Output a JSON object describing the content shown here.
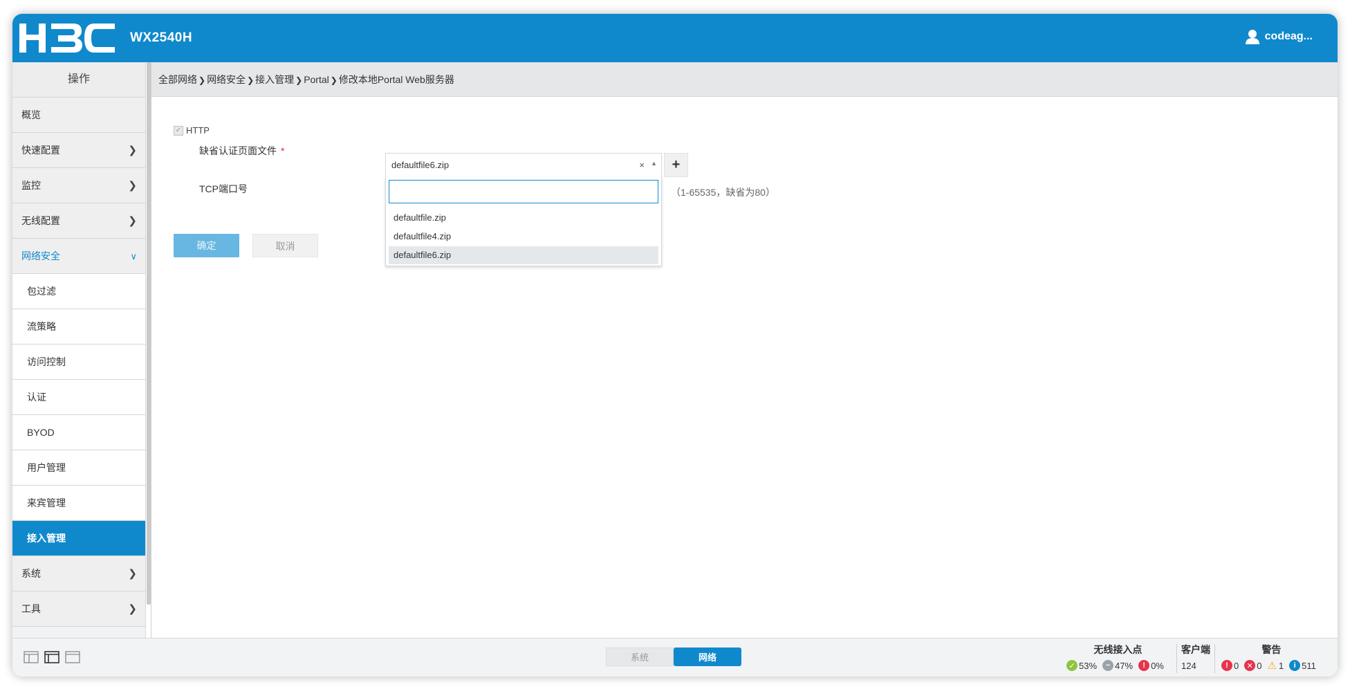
{
  "header": {
    "logo": "H3C",
    "model": "WX2540H",
    "user": "codeag..."
  },
  "sidebar": {
    "title": "操作",
    "items": [
      {
        "label": "概览"
      },
      {
        "label": "快速配置"
      },
      {
        "label": "监控"
      },
      {
        "label": "无线配置"
      },
      {
        "label": "网络安全"
      },
      {
        "label": "包过滤"
      },
      {
        "label": "流策略"
      },
      {
        "label": "访问控制"
      },
      {
        "label": "认证"
      },
      {
        "label": "BYOD"
      },
      {
        "label": "用户管理"
      },
      {
        "label": "来宾管理"
      },
      {
        "label": "接入管理"
      },
      {
        "label": "系统"
      },
      {
        "label": "工具"
      }
    ]
  },
  "breadcrumb": [
    "全部网络",
    "网络安全",
    "接入管理",
    "Portal",
    "修改本地Portal Web服务器"
  ],
  "form": {
    "http_label": "HTTP",
    "file_label": "缺省认证页面文件",
    "required_mark": "*",
    "selected_file": "defaultfile6.zip",
    "clear_symbol": "×",
    "add_symbol": "+",
    "port_label": "TCP端口号",
    "port_hint": "（1-65535，缺省为80）",
    "search_value": "",
    "options": [
      "defaultfile.zip",
      "defaultfile4.zip",
      "defaultfile6.zip"
    ],
    "ok_label": "确定",
    "cancel_label": "取消"
  },
  "footer": {
    "tabs": [
      "系统",
      "网络"
    ],
    "ap": {
      "title": "无线接入点",
      "online": "53%",
      "offline": "47%",
      "fault": "0%"
    },
    "clients": {
      "title": "客户端",
      "count": "124"
    },
    "alarms": {
      "title": "警告",
      "critical": "0",
      "major": "0",
      "minor": "1",
      "info": "511"
    }
  },
  "colors": {
    "brand": "#1089cc",
    "ok": "#8cc63f",
    "warn": "#f5a623",
    "error": "#e8334a",
    "info": "#1089cc"
  }
}
